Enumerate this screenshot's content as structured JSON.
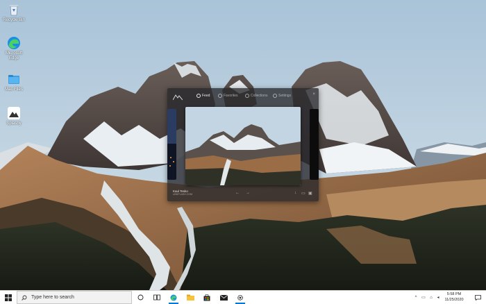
{
  "desktop": {
    "icons": [
      {
        "label": "Recycle Bin",
        "icon": "recycle-bin-icon"
      },
      {
        "label": "Microsoft Edge",
        "icon": "edge-icon"
      },
      {
        "label": "Mac Files",
        "icon": "folder-icon"
      },
      {
        "label": "Splashy",
        "icon": "splashy-icon"
      }
    ]
  },
  "splashy": {
    "nav": [
      {
        "label": "Feed",
        "icon": "home-icon",
        "active": true
      },
      {
        "label": "Favorites",
        "icon": "heart-icon",
        "active": false
      },
      {
        "label": "Collections",
        "icon": "collections-icon",
        "active": false
      },
      {
        "label": "Settings",
        "icon": "gear-icon",
        "active": false
      }
    ],
    "photo": {
      "author": "Kaul Tesko",
      "source": "UNSPLASH.COM"
    }
  },
  "taskbar": {
    "search_placeholder": "Type here to search",
    "time": "5:58 PM",
    "date": "11/25/2020",
    "pinned": [
      "task-view-icon",
      "edge-icon",
      "file-explorer-icon",
      "store-icon",
      "mail-icon",
      "settings-icon"
    ]
  },
  "colors": {
    "accent": "#0078d7",
    "taskbar_bg": "#ffffff",
    "sky": "#b9cfdf"
  }
}
